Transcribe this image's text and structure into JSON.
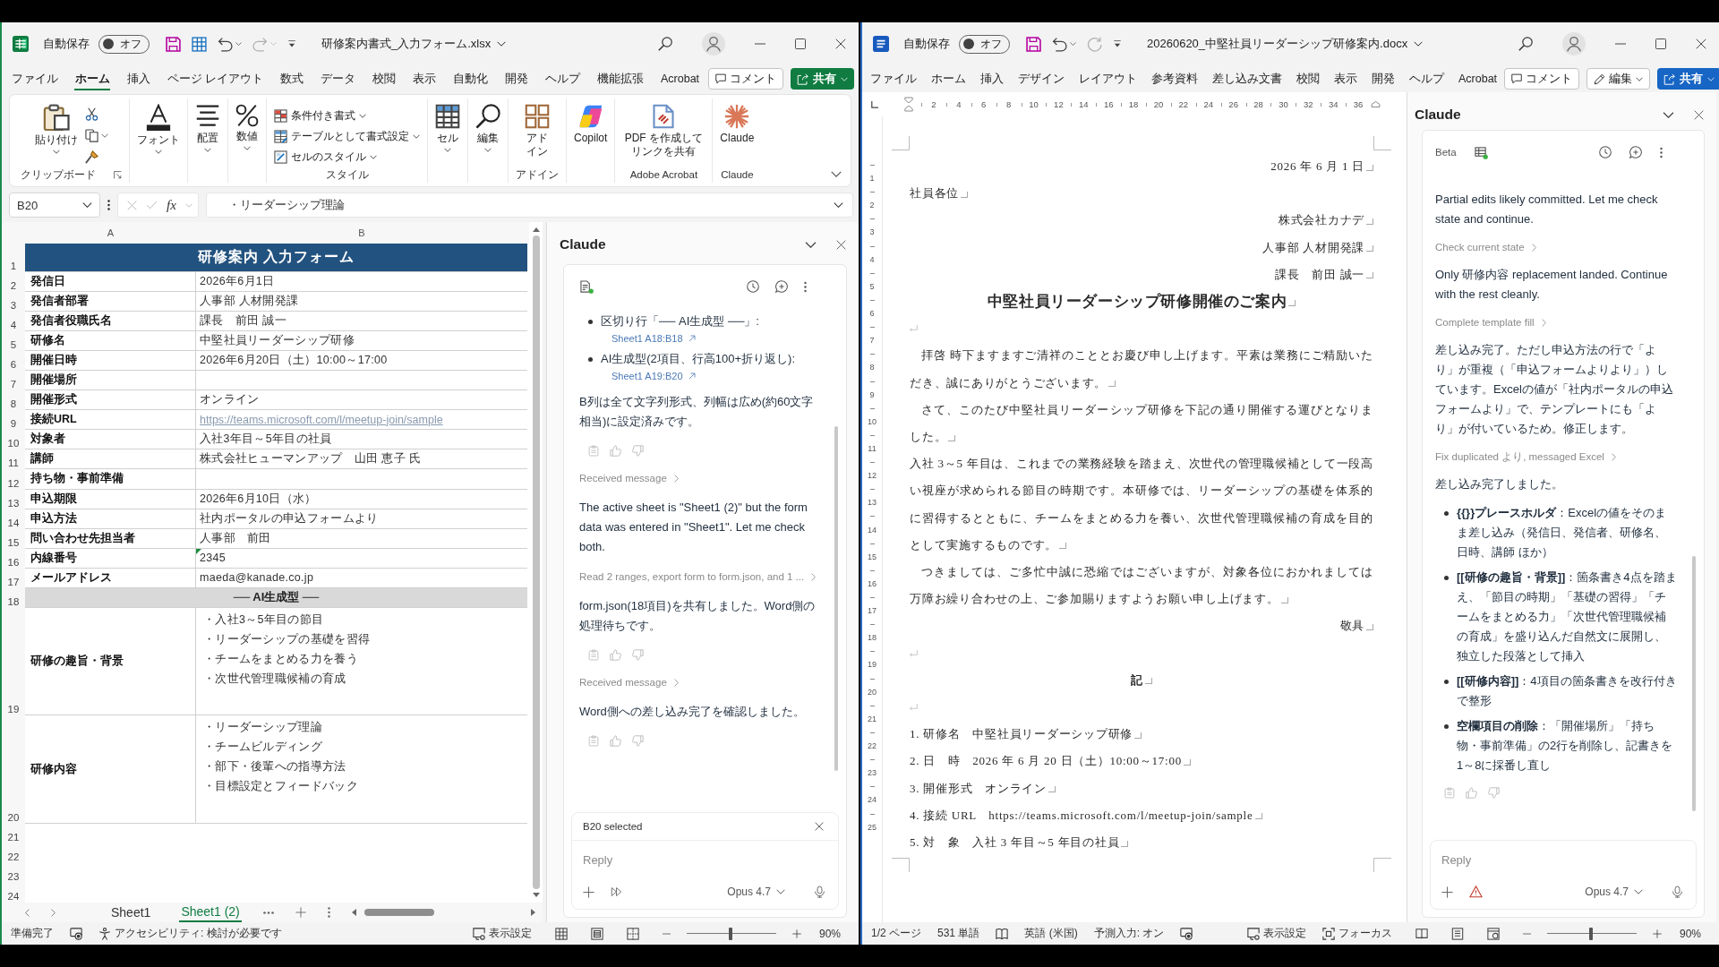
{
  "excel": {
    "title_bar": {
      "autosave_label": "自動保存",
      "autosave": {
        "on": false,
        "label": "オフ"
      },
      "file_name": "研修案内書式_入力フォーム.xlsx"
    },
    "menu_tabs": [
      {
        "label": "ファイル",
        "selected": false
      },
      {
        "label": "ホーム",
        "selected": true
      },
      {
        "label": "挿入",
        "selected": false
      },
      {
        "label": "ページ レイアウト",
        "selected": false
      },
      {
        "label": "数式",
        "selected": false
      },
      {
        "label": "データ",
        "selected": false
      },
      {
        "label": "校閲",
        "selected": false
      },
      {
        "label": "表示",
        "selected": false
      },
      {
        "label": "自動化",
        "selected": false
      },
      {
        "label": "開発",
        "selected": false
      },
      {
        "label": "ヘルプ",
        "selected": false
      },
      {
        "label": "機能拡張",
        "selected": false
      },
      {
        "label": "Acrobat",
        "selected": false
      }
    ],
    "comment_button": "コメント",
    "share_button": "共有",
    "ribbon": {
      "clipboard": {
        "paste": "貼り付け",
        "label": "クリップボード"
      },
      "font": "フォント",
      "alignment": "配置",
      "number": "数値",
      "styles": {
        "items": [
          "条件付き書式",
          "テーブルとして書式設定",
          "セルのスタイル"
        ],
        "label": "スタイル"
      },
      "cells": "セル",
      "editing": "編集",
      "addins": {
        "button": "アドイン",
        "label": "アドイン"
      },
      "copilot": "Copilot",
      "acrobat": {
        "button": "PDF を作成してリンクを共有",
        "label": "Adobe Acrobat"
      },
      "claude": {
        "button": "Claude",
        "label": "Claude"
      }
    },
    "formula_bar": {
      "name_box": "B20",
      "function_label": "fx",
      "formula": "・リーダーシップ理論"
    },
    "sheet": {
      "columns": [
        "A",
        "B"
      ],
      "rows": [
        {
          "number": "1",
          "kind": "title",
          "text": "研修案内 入力フォーム"
        },
        {
          "number": "2",
          "kind": "field",
          "label": "発信日",
          "value": "2026年6月1日",
          "flagged": false
        },
        {
          "number": "3",
          "kind": "field",
          "label": "発信者部署",
          "value": "人事部 人材開発課",
          "flagged": false
        },
        {
          "number": "4",
          "kind": "field",
          "label": "発信者役職氏名",
          "value": "課長　前田 誠一",
          "flagged": false
        },
        {
          "number": "5",
          "kind": "field",
          "label": "研修名",
          "value": "中堅社員リーダーシップ研修",
          "flagged": false
        },
        {
          "number": "6",
          "kind": "field",
          "label": "開催日時",
          "value": "2026年6月20日（土）10:00～17:00",
          "flagged": false
        },
        {
          "number": "7",
          "kind": "field",
          "label": "開催場所",
          "flagged": false
        },
        {
          "number": "8",
          "kind": "field",
          "label": "開催形式",
          "value": "オンライン",
          "flagged": false
        },
        {
          "number": "9",
          "kind": "link",
          "label": "接続URL",
          "value": "https://teams.microsoft.com/l/meetup-join/sample",
          "flagged": false
        },
        {
          "number": "10",
          "kind": "field",
          "label": "対象者",
          "value": "入社3年目～5年目の社員",
          "flagged": false
        },
        {
          "number": "11",
          "kind": "field",
          "label": "講師",
          "value": "株式会社ヒューマンアップ　山田 恵子 氏",
          "flagged": false
        },
        {
          "number": "12",
          "kind": "field",
          "label": "持ち物・事前準備",
          "flagged": false
        },
        {
          "number": "13",
          "kind": "field",
          "label": "申込期限",
          "value": "2026年6月10日（水）",
          "flagged": false
        },
        {
          "number": "14",
          "kind": "field",
          "label": "申込方法",
          "value": "社内ポータルの申込フォームより",
          "flagged": false
        },
        {
          "number": "15",
          "kind": "field",
          "label": "問い合わせ先担当者",
          "value": "人事部　前田",
          "flagged": false
        },
        {
          "number": "16",
          "kind": "field",
          "label": "内線番号",
          "value": "2345",
          "flagged": true
        },
        {
          "number": "17",
          "kind": "field",
          "label": "メールアドレス",
          "value": "maeda@kanade.co.jp",
          "flagged": false
        },
        {
          "number": "18",
          "kind": "section",
          "text": "── AI生成型 ──"
        },
        {
          "number": "19",
          "kind": "multiline",
          "label": "研修の趣旨・背景",
          "lines": [
            "・入社3～5年目の節目",
            "・リーダーシップの基礎を習得",
            "・チームをまとめる力を養う",
            "・次世代管理職候補の育成"
          ]
        },
        {
          "number": "20",
          "kind": "multiline",
          "label": "研修内容",
          "lines": [
            "・リーダーシップ理論",
            "・チームビルディング",
            "・部下・後輩への指導方法",
            "・目標設定とフィードバック"
          ]
        },
        {
          "number": "21",
          "kind": "blank"
        },
        {
          "number": "22",
          "kind": "blank"
        },
        {
          "number": "23",
          "kind": "blank"
        },
        {
          "number": "24",
          "kind": "blank"
        }
      ]
    },
    "sheet_tabs": [
      {
        "label": "Sheet1",
        "selected": false
      },
      {
        "label": "Sheet1 (2)",
        "selected": true
      }
    ],
    "claude_pane": {
      "title": "Claude",
      "messages": [
        {
          "kind": "bullets",
          "items": [
            {
              "text": "区切り行「── AI生成型 ──」:",
              "link": "Sheet1 A18:B18"
            },
            {
              "text": "AI生成型(2項目、行高100+折り返し):",
              "link": "Sheet1 A19:B20"
            }
          ]
        },
        {
          "kind": "text",
          "text": "B列は全て文字列形式、列幅は広め(約60文字相当)に設定済みです。"
        },
        {
          "kind": "feedback"
        },
        {
          "kind": "step",
          "text": "Received message"
        },
        {
          "kind": "text",
          "text": "The active sheet is \"Sheet1 (2)\" but the form data was entered in \"Sheet1\". Let me check both."
        },
        {
          "kind": "step",
          "text": "Read 2 ranges, export form to form.json, and 1 ..."
        },
        {
          "kind": "text",
          "text": "form.json(18項目)を共有しました。Word側の処理待ちです。"
        },
        {
          "kind": "feedback"
        },
        {
          "kind": "step",
          "text": "Received message"
        },
        {
          "kind": "text",
          "text": "Word側への差し込み完了を確認しました。"
        },
        {
          "kind": "feedback"
        }
      ],
      "context_chip": "B20 selected",
      "reply_placeholder": "Reply",
      "model": "Opus 4.7"
    },
    "status_bar": {
      "status": "準備完了",
      "accessibility": "アクセシビリティ: 検討が必要です",
      "display_settings": "表示設定",
      "zoom": {
        "level": 0.49,
        "reading": "90%"
      }
    }
  },
  "word": {
    "title_bar": {
      "autosave_label": "自動保存",
      "autosave": {
        "on": false,
        "label": "オフ"
      },
      "file_name": "20260620_中堅社員リーダーシップ研修案内.docx"
    },
    "menu_tabs": [
      {
        "label": "ファイル",
        "selected": false
      },
      {
        "label": "ホーム",
        "selected": false
      },
      {
        "label": "挿入",
        "selected": false
      },
      {
        "label": "デザイン",
        "selected": false
      },
      {
        "label": "レイアウト",
        "selected": false
      },
      {
        "label": "参考資料",
        "selected": false
      },
      {
        "label": "差し込み文書",
        "selected": false
      },
      {
        "label": "校閲",
        "selected": false
      },
      {
        "label": "表示",
        "selected": false
      },
      {
        "label": "開発",
        "selected": false
      },
      {
        "label": "ヘルプ",
        "selected": false
      },
      {
        "label": "Acrobat",
        "selected": false
      }
    ],
    "comment_button": "コメント",
    "edit_button": "編集",
    "share_button": "共有",
    "ruler": [
      "2",
      "4",
      "6",
      "8",
      "10",
      "12",
      "14",
      "16",
      "18",
      "20",
      "22",
      "24",
      "26",
      "28",
      "30",
      "32",
      "34",
      "36"
    ],
    "vertical_ruler": [
      "1",
      "2",
      "3",
      "4",
      "5",
      "6",
      "7",
      "8",
      "9",
      "10",
      "11",
      "12",
      "13",
      "14",
      "15",
      "16",
      "17",
      "18",
      "19",
      "20",
      "21",
      "22",
      "23",
      "24",
      "25"
    ],
    "paragraphs": [
      {
        "kind": "right",
        "text": "2026 年 6 月 1 日"
      },
      {
        "kind": "plain",
        "text": "社員各位"
      },
      {
        "kind": "right",
        "text": "株式会社カナデ"
      },
      {
        "kind": "right",
        "text": "人事部 人材開発課"
      },
      {
        "kind": "right",
        "text": "課長　前田 誠一"
      },
      {
        "kind": "title",
        "text": "中堅社員リーダーシップ研修開催のご案内"
      },
      {
        "kind": "empty"
      },
      {
        "kind": "indent",
        "text": "拝啓 時下ますますご清祥のこととお慶び申し上げます。平素は業務にご精励いただき、誠にありがとうございます。"
      },
      {
        "kind": "indent",
        "text": "さて、このたび中堅社員リーダーシップ研修を下記の通り開催する運びとなりました。"
      },
      {
        "kind": "plain",
        "text": "入社 3～5 年目は、これまでの業務経験を踏まえ、次世代の管理職候補として一段高い視座が求められる節目の時期です。本研修では、リーダーシップの基礎を体系的に習得するとともに、チームをまとめる力を養い、次世代管理職候補の育成を目的として実施するものです。"
      },
      {
        "kind": "indent",
        "text": "つきましては、ご多忙中誠に恐縮ではございますが、対象各位におかれましては万障お繰り合わせの上、ご参加賜りますようお願い申し上げます。"
      },
      {
        "kind": "right",
        "text": "敬具"
      },
      {
        "kind": "empty"
      },
      {
        "kind": "center",
        "text": "記"
      },
      {
        "kind": "empty"
      },
      {
        "kind": "plain",
        "text": "1. 研修名　中堅社員リーダーシップ研修"
      },
      {
        "kind": "plain",
        "text": "2. 日　時　2026 年 6 月 20 日（土）10:00～17:00"
      },
      {
        "kind": "plain",
        "text": "3. 開催形式　オンライン"
      },
      {
        "kind": "plain",
        "text": "4. 接続 URL　https://teams.microsoft.com/l/meetup-join/sample"
      },
      {
        "kind": "plain",
        "text": "5. 対　象　入社 3 年目～5 年目の社員"
      }
    ],
    "claude_pane": {
      "title": "Claude",
      "badge": "Beta",
      "messages": [
        {
          "kind": "text",
          "text": "Partial edits likely committed. Let me check state and continue."
        },
        {
          "kind": "step",
          "text": "Check current state"
        },
        {
          "kind": "text",
          "text": "Only 研修内容 replacement landed. Continue with the rest cleanly."
        },
        {
          "kind": "step",
          "text": "Complete template fill"
        },
        {
          "kind": "text",
          "text": "差し込み完了。ただし申込方法の行で「より」が重複（「申込フォームよりより」）しています。Excelの値が「社内ポータルの申込フォームより」で、テンプレートにも「より」が付いているため。修正します。"
        },
        {
          "kind": "step",
          "text": "Fix duplicated より, messaged Excel"
        },
        {
          "kind": "text",
          "text": "差し込み完了しました。"
        },
        {
          "kind": "bullets",
          "items": [
            {
              "text": "**{{}}プレースホルダ**：Excelの値をそのまま差し込み（発信日、発信者、研修名、日時、講師 ほか）"
            },
            {
              "text": "**[[研修の趣旨・背景]]**：箇条書き4点を踏まえ、「節目の時期」「基礎の習得」「チームをまとめる力」「次世代管理職候補の育成」を盛り込んだ自然文に展開し、独立した段落として挿入"
            },
            {
              "text": "**[[研修内容]]**：4項目の箇条書きを改行付きで整形"
            },
            {
              "text": "**空欄項目の削除**：「開催場所」「持ち物・事前準備」の2行を削除し、記書きを1～8に採番し直し"
            }
          ]
        },
        {
          "kind": "feedback"
        }
      ],
      "reply_placeholder": "Reply",
      "model": "Opus 4.7"
    },
    "status_bar": {
      "page": "1/2 ページ",
      "words": "531 単語",
      "language": "英語 (米国)",
      "prediction": "予測入力: オン",
      "display_settings": "表示設定",
      "focus": "フォーカス",
      "zoom": {
        "level": 0.49,
        "reading": "90%"
      }
    }
  }
}
